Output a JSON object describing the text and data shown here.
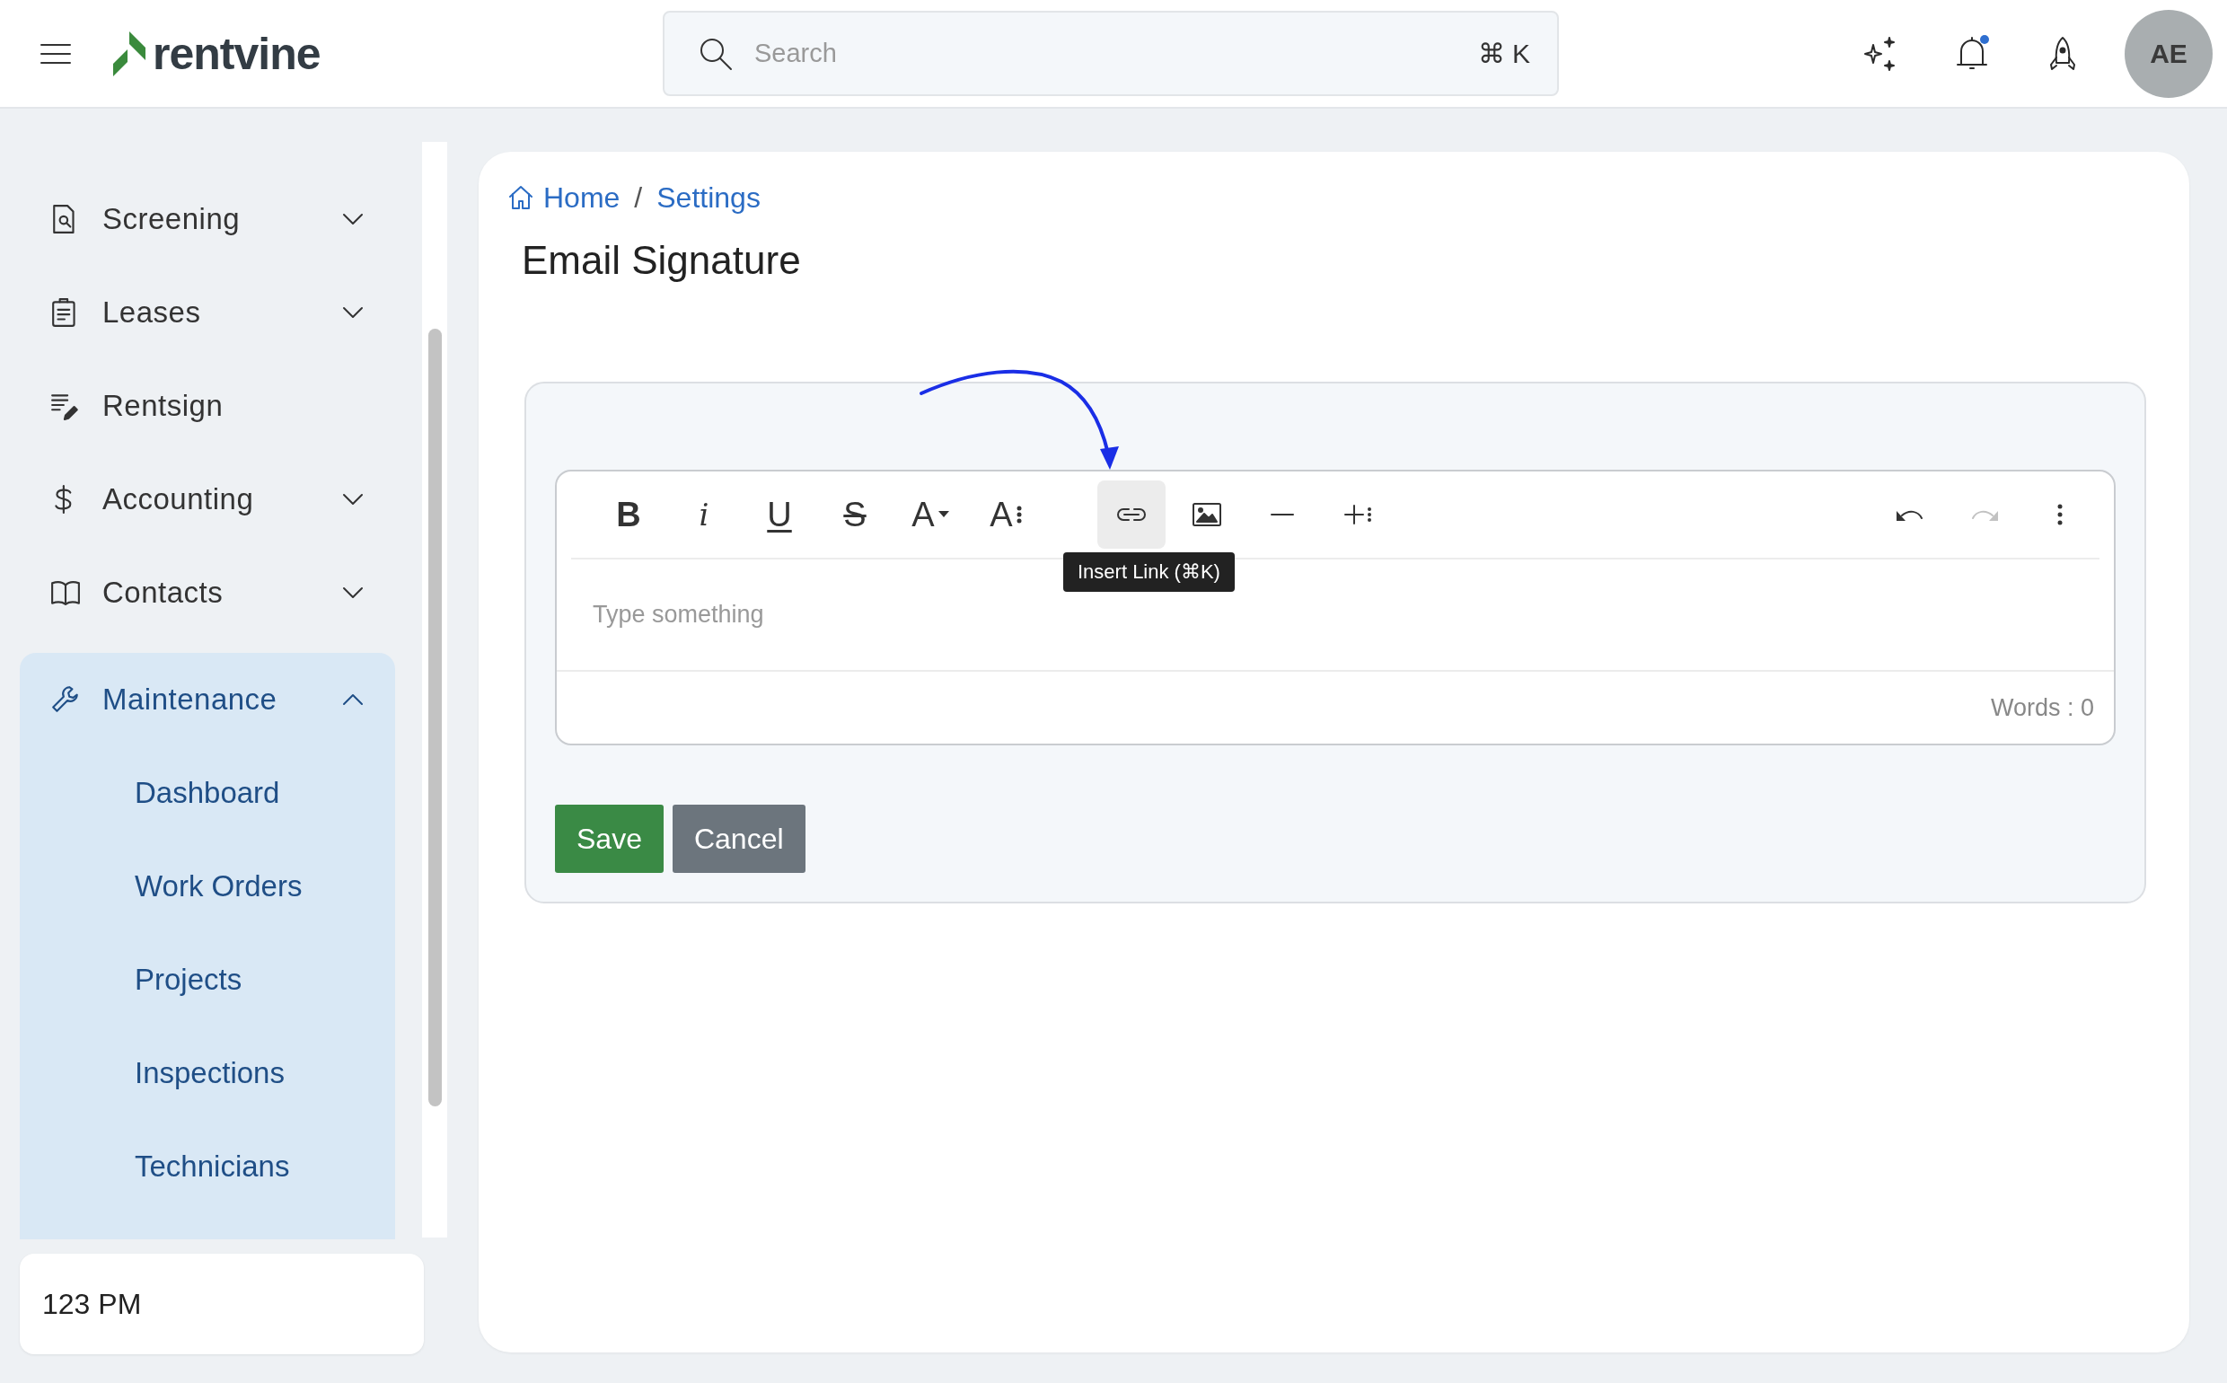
{
  "header": {
    "logo": "rentvine",
    "search": {
      "placeholder": "Search",
      "shortcut": "⌘ K"
    },
    "notifications": {
      "unread": true
    },
    "avatar": "AE"
  },
  "sidebar": {
    "items": [
      {
        "kind": "screening",
        "label": "Screening",
        "expanded": false,
        "selected": false
      },
      {
        "kind": "leases",
        "label": "Leases",
        "expanded": false,
        "selected": false
      },
      {
        "kind": "rentsign",
        "label": "Rentsign",
        "selected": false
      },
      {
        "kind": "accounting",
        "label": "Accounting",
        "expanded": false,
        "selected": false
      },
      {
        "kind": "contacts",
        "label": "Contacts",
        "expanded": false,
        "selected": false
      },
      {
        "kind": "maintenance",
        "label": "Maintenance",
        "expanded": true,
        "selected": true,
        "children": [
          {
            "label": "Dashboard",
            "selected": false
          },
          {
            "label": "Work Orders",
            "selected": false
          },
          {
            "label": "Projects",
            "selected": false
          },
          {
            "label": "Inspections",
            "selected": false
          },
          {
            "label": "Technicians",
            "selected": false
          }
        ]
      }
    ],
    "footer": "123 PM"
  },
  "breadcrumb": {
    "items": [
      "Home",
      "Settings"
    ],
    "separator": "/"
  },
  "title": "Email Signature",
  "editor": {
    "groups": [
      {
        "buttons": [
          {
            "kind": "bold",
            "label": "B",
            "active": false,
            "disabled": false
          },
          {
            "kind": "italic",
            "label": "i",
            "active": false,
            "disabled": false
          },
          {
            "kind": "underline",
            "label": "U",
            "active": false,
            "disabled": false
          },
          {
            "kind": "strike",
            "label": "S",
            "active": false,
            "disabled": false
          },
          {
            "kind": "color",
            "label": "A",
            "active": false,
            "disabled": false
          },
          {
            "kind": "size",
            "label": "A",
            "active": false,
            "disabled": false
          }
        ]
      },
      {
        "buttons": [
          {
            "kind": "link",
            "active": true,
            "disabled": false,
            "tooltip": "Insert Link (⌘K)"
          },
          {
            "kind": "image",
            "active": false,
            "disabled": false
          },
          {
            "kind": "rule",
            "active": false,
            "disabled": false
          },
          {
            "kind": "insert",
            "active": false,
            "disabled": false
          }
        ]
      },
      {
        "buttons": [
          {
            "kind": "undo",
            "active": false,
            "disabled": false
          },
          {
            "kind": "redo",
            "active": false,
            "disabled": true
          },
          {
            "kind": "more",
            "active": false,
            "disabled": false
          }
        ]
      }
    ],
    "placeholder": "Type something",
    "word_count": "Words : 0"
  },
  "actions": [
    {
      "kind": "primary",
      "label": "Save"
    },
    {
      "kind": "secondary",
      "label": "Cancel"
    }
  ]
}
